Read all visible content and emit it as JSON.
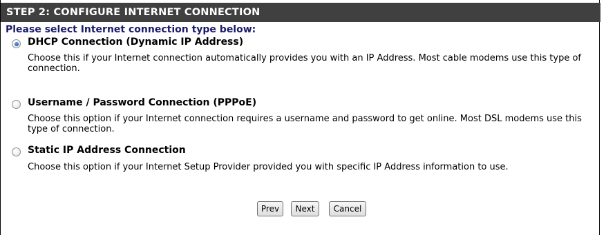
{
  "step_header": "STEP 2: CONFIGURE INTERNET CONNECTION",
  "prompt": "Please select Internet connection type below:",
  "options": [
    {
      "label": "DHCP Connection (Dynamic IP Address)",
      "description": "Choose this if your Internet connection automatically provides you with an IP Address. Most cable modems use this type of connection.",
      "selected": true
    },
    {
      "label": "Username / Password Connection (PPPoE)",
      "description": "Choose this option if your Internet connection requires a username and password to get online. Most DSL modems use this type of connection.",
      "selected": false
    },
    {
      "label": "Static IP Address Connection",
      "description": "Choose this option if your Internet Setup Provider provided you with specific IP Address information to use.",
      "selected": false
    }
  ],
  "buttons": {
    "prev": "Prev",
    "next": "Next",
    "cancel": "Cancel"
  },
  "colors": {
    "header_bg": "#404040",
    "prompt_text": "#1a1a6a"
  }
}
